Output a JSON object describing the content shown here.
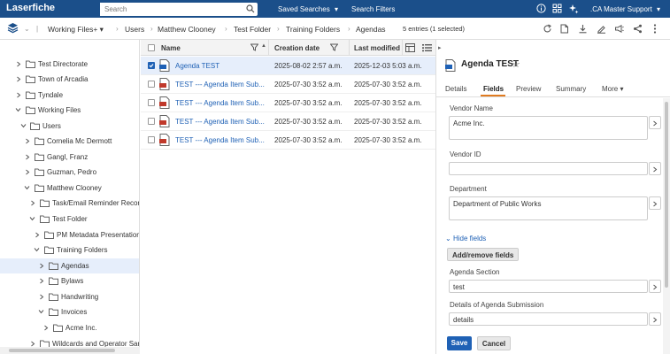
{
  "app": {
    "logo": "Laserfiche"
  },
  "topbar": {
    "search_placeholder": "Search",
    "saved_searches": "Saved Searches",
    "search_filters": "Search Filters",
    "user": ".CA Master Support"
  },
  "breadcrumb": {
    "root": "Working Files+",
    "items": [
      "Users",
      "Matthew Clooney",
      "Test Folder",
      "Training Folders",
      "Agendas"
    ],
    "entries": "5 entries (1 selected)"
  },
  "tree": [
    "Test Directorate",
    "Town of Arcadia",
    "Tyndale",
    "Working Files",
    "Users",
    "Cornelia Mc Dermott",
    "Gangl, Franz",
    "Guzman, Pedro",
    "Matthew Clooney",
    "Task/Email Reminder Records",
    "Test Folder",
    "PM Metadata Presentation",
    "Training Folders",
    "Agendas",
    "Bylaws",
    "Handwriting",
    "Invoices",
    "Acme Inc.",
    "Wildcards and Operator Sandbox"
  ],
  "list": {
    "columns": {
      "name": "Name",
      "created": "Creation date",
      "modified": "Last modified"
    },
    "rows": [
      {
        "name": "Agenda TEST",
        "created": "2025-08-02 2:57 a.m.",
        "modified": "2025-12-03 5:03 a.m."
      },
      {
        "name": "TEST --- Agenda Item Sub...",
        "created": "2025-07-30 3:52 a.m.",
        "modified": "2025-07-30 3:52 a.m."
      },
      {
        "name": "TEST --- Agenda Item Sub...",
        "created": "2025-07-30 3:52 a.m.",
        "modified": "2025-07-30 3:52 a.m."
      },
      {
        "name": "TEST --- Agenda Item Sub...",
        "created": "2025-07-30 3:52 a.m.",
        "modified": "2025-07-30 3:52 a.m."
      },
      {
        "name": "TEST --- Agenda Item Sub...",
        "created": "2025-07-30 3:52 a.m.",
        "modified": "2025-07-30 3:52 a.m."
      }
    ]
  },
  "details": {
    "title": "Agenda TEST",
    "tabs": [
      "Details",
      "Fields",
      "Preview",
      "Summary",
      "More"
    ],
    "fields": {
      "vendor_name_label": "Vendor Name",
      "vendor_name_value": "Acme Inc.",
      "vendor_id_label": "Vendor ID",
      "vendor_id_value": "",
      "department_label": "Department",
      "department_value": "Department of Public Works",
      "hide_fields": "Hide fields",
      "add_remove": "Add/remove fields",
      "agenda_section_label": "Agenda Section",
      "agenda_section_value": "test",
      "details_label": "Details of Agenda Submission",
      "details_value": "details"
    },
    "save": "Save",
    "cancel": "Cancel"
  },
  "colors": {
    "topbar": "#1b4f8a",
    "accent": "#1f61b5",
    "tab_underline": "#e07b20",
    "selection": "#e6eefb"
  }
}
